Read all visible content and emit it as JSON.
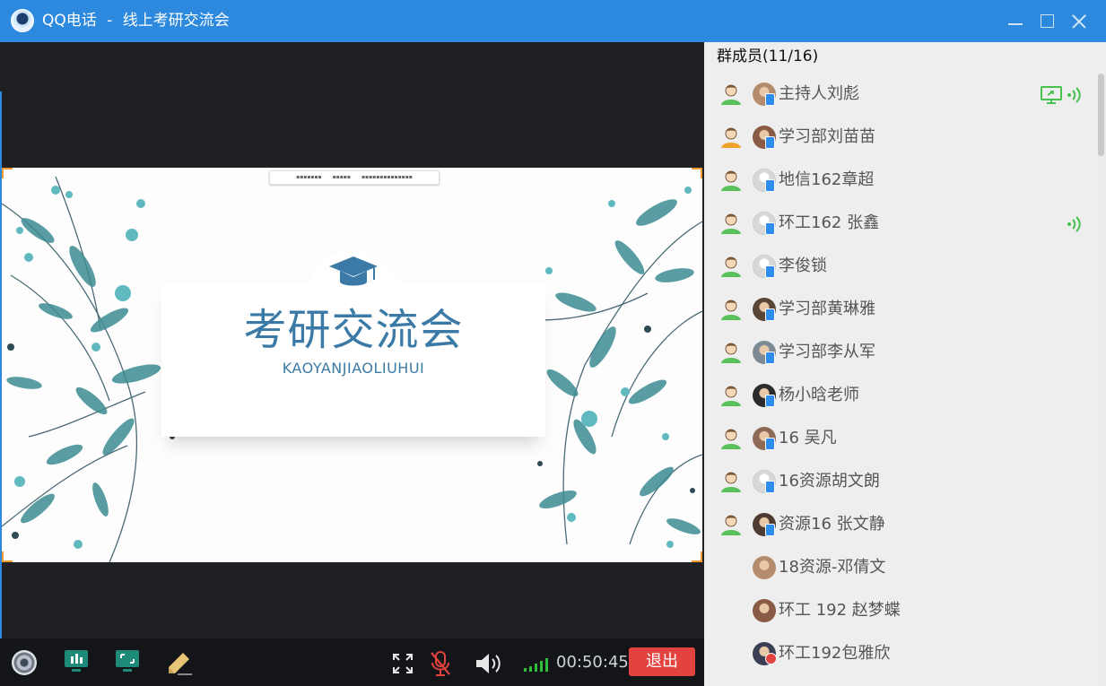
{
  "window": {
    "app_name": "QQ电话",
    "separator": "-",
    "meeting_title": "线上考研交流会"
  },
  "slide": {
    "title": "考研交流会",
    "subtitle": "KAOYANJIAOLIUHUI",
    "accent_color": "#3b7aa6",
    "leaf_color": "#3d8d92"
  },
  "toolbar": {
    "call_time": "00:50:45",
    "exit_label": "退出",
    "signal_color": "#2fbf3a",
    "mic_muted_color": "#e3433f"
  },
  "members": {
    "header": "群成员(11/16)",
    "items": [
      {
        "name": "主持人刘彪",
        "role": "member",
        "avatar": "photo-avatar",
        "screen_share": true,
        "speaking": true
      },
      {
        "name": "学习部刘苗苗",
        "role": "admin",
        "avatar": "photo-avatar",
        "screen_share": false,
        "speaking": false
      },
      {
        "name": "地信162章超",
        "role": "member",
        "avatar": "default-avatar",
        "screen_share": false,
        "speaking": false
      },
      {
        "name": "环工162 张鑫",
        "role": "member",
        "avatar": "default-avatar",
        "screen_share": false,
        "speaking": true
      },
      {
        "name": "李俊锁",
        "role": "member",
        "avatar": "default-avatar",
        "screen_share": false,
        "speaking": false
      },
      {
        "name": "学习部黄琳雅",
        "role": "member",
        "avatar": "photo-avatar",
        "screen_share": false,
        "speaking": false
      },
      {
        "name": "学习部李从军",
        "role": "member",
        "avatar": "photo-avatar",
        "screen_share": false,
        "speaking": false
      },
      {
        "name": "杨小晗老师",
        "role": "member",
        "avatar": "photo-avatar",
        "screen_share": false,
        "speaking": false
      },
      {
        "name": "16 吴凡",
        "role": "member",
        "avatar": "photo-avatar",
        "screen_share": false,
        "speaking": false
      },
      {
        "name": "16资源胡文朗",
        "role": "member",
        "avatar": "default-avatar",
        "screen_share": false,
        "speaking": false
      },
      {
        "name": "资源16 张文静",
        "role": "member",
        "avatar": "photo-avatar",
        "screen_share": false,
        "speaking": false
      },
      {
        "name": "18资源-邓倩文",
        "role": "none",
        "avatar": "photo-avatar",
        "screen_share": false,
        "speaking": false
      },
      {
        "name": "环工 192 赵梦蝶",
        "role": "none",
        "avatar": "photo-avatar",
        "screen_share": false,
        "speaking": false
      },
      {
        "name": "环工192包雅欣",
        "role": "none",
        "avatar": "photo-avatar",
        "screen_share": false,
        "speaking": false
      }
    ]
  },
  "colors": {
    "titlebar": "#2c89dd",
    "member_role_green": "#5ac15a",
    "member_role_orange": "#f0a32b",
    "speaking_green": "#47c14d"
  }
}
